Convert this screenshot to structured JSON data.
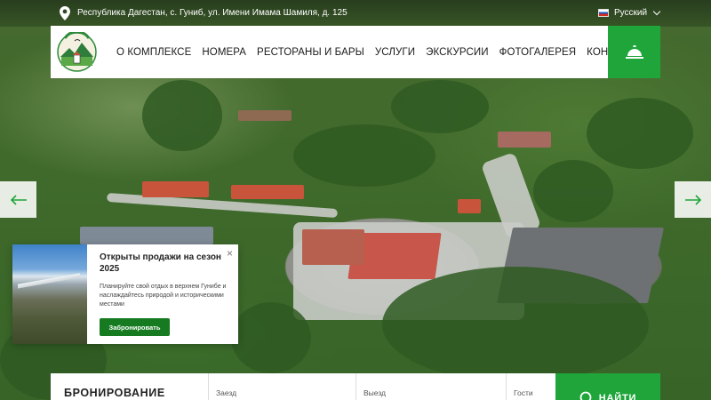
{
  "topbar": {
    "address": "Республика Дагестан, с. Гуниб, ул. Имени Имама Шамиля, д. 125",
    "language": "Русский",
    "pin_icon": "location-pin-icon",
    "flag_icon": "russia-flag-icon"
  },
  "nav": {
    "logo_icon": "resort-logo-icon",
    "items": [
      {
        "label": "О КОМПЛЕКСЕ"
      },
      {
        "label": "НОМЕРА"
      },
      {
        "label": "РЕСТОРАНЫ И БАРЫ"
      },
      {
        "label": "УСЛУГИ"
      },
      {
        "label": "ЭКСКУРСИИ"
      },
      {
        "label": "ФОТОГАЛЕРЕЯ"
      },
      {
        "label": "КОНТАКТЫ"
      }
    ],
    "bell_icon": "reception-bell-icon"
  },
  "slider": {
    "prev_icon": "arrow-left-icon",
    "next_icon": "arrow-right-icon"
  },
  "popup": {
    "title": "Открыты продажи на сезон 2025",
    "text": "Планируйте свой отдых в верхнем Гунибе и наслаждайтесь природой и историческими местами",
    "button": "Забронировать",
    "close": "×"
  },
  "booking": {
    "title": "БРОНИРОВАНИЕ",
    "checkin_label": "Заезд",
    "checkout_label": "Выезд",
    "guests_label": "Гости",
    "search_label": "НАЙТИ",
    "search_icon": "search-icon"
  },
  "colors": {
    "accent": "#1fa53a",
    "button_dark": "#157a20"
  }
}
